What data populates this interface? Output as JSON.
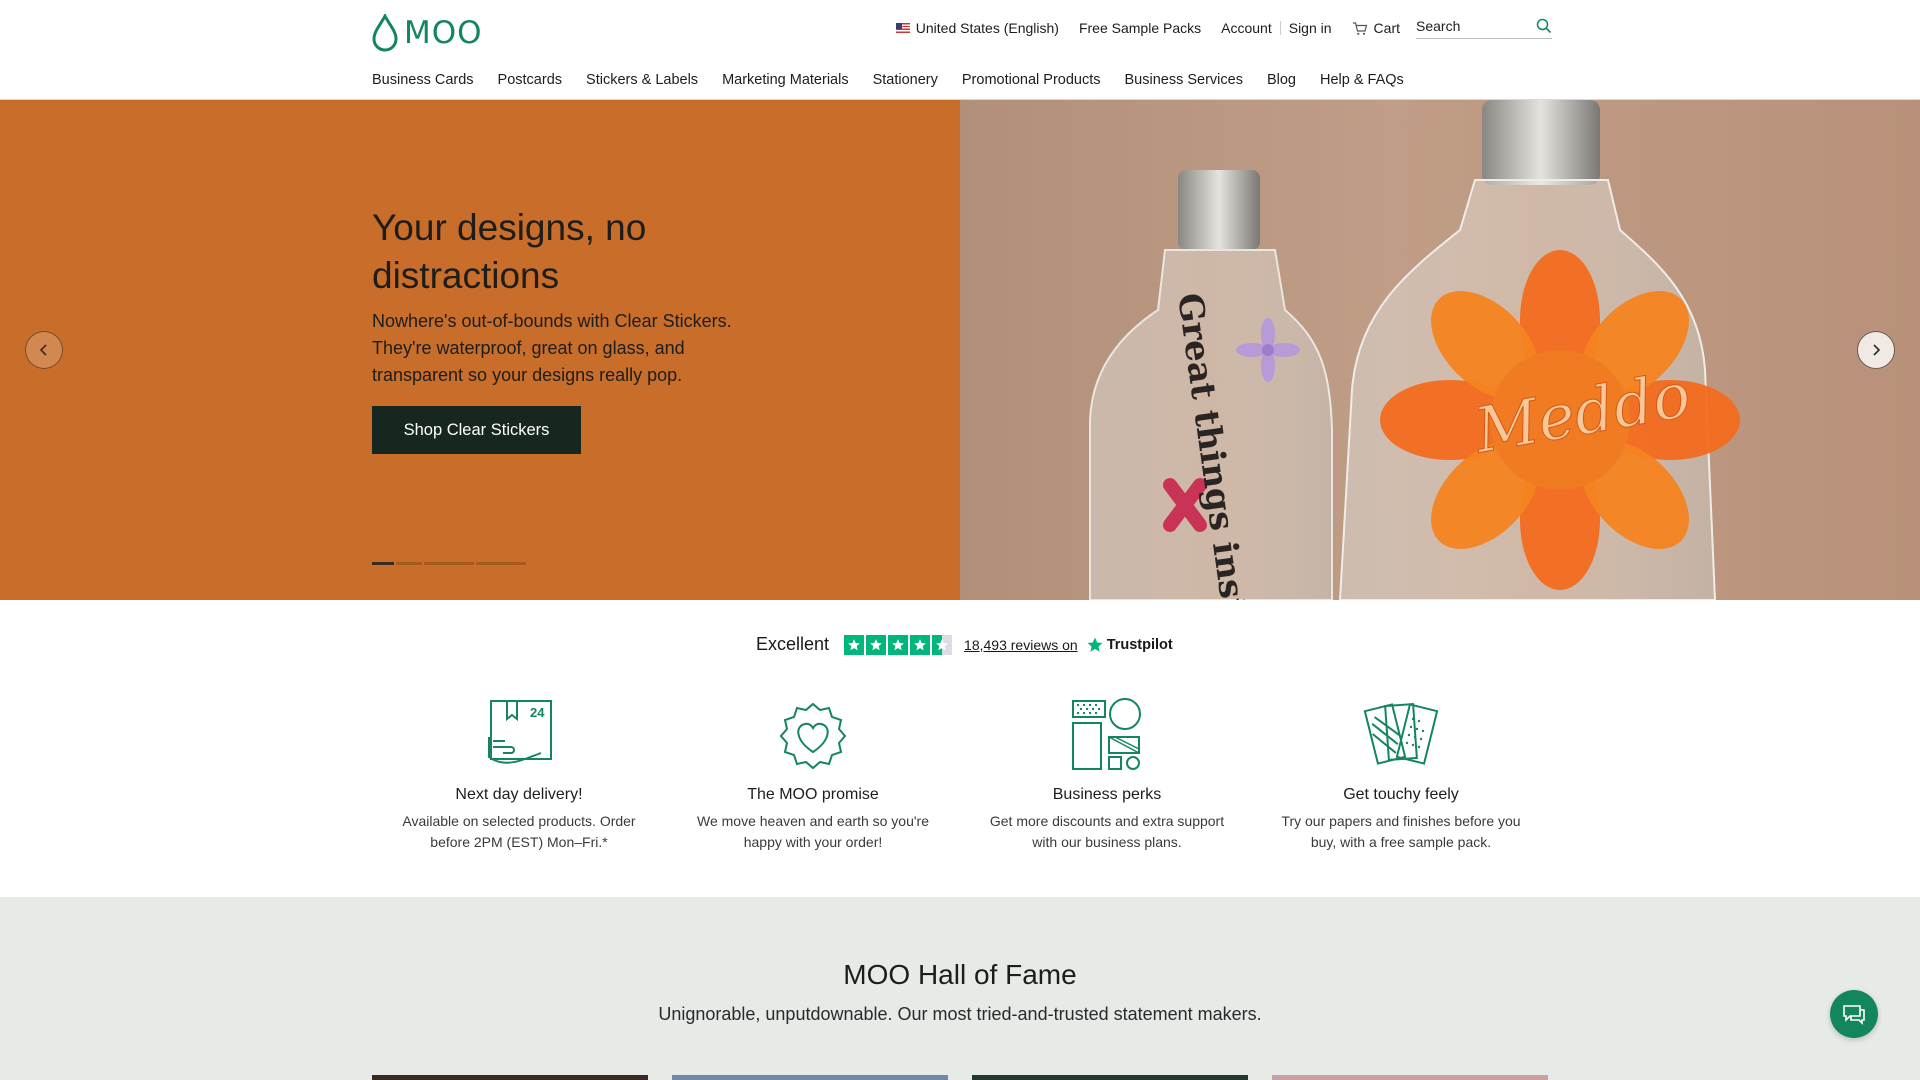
{
  "header": {
    "logo_text": "MOO",
    "utility": {
      "region": "United States (English)",
      "free_samples": "Free Sample Packs",
      "account": "Account",
      "sign_in": "Sign in",
      "cart": "Cart",
      "search_placeholder": "Search"
    },
    "nav": [
      "Business Cards",
      "Postcards",
      "Stickers & Labels",
      "Marketing Materials",
      "Stationery",
      "Promotional Products",
      "Business Services",
      "Blog",
      "Help & FAQs"
    ]
  },
  "hero": {
    "title": "Your designs, no distractions",
    "description": "Nowhere's out-of-bounds with Clear Stickers. They're waterproof, great on glass, and transparent so your designs really pop.",
    "cta": "Shop Clear Stickers",
    "slide_count": 4,
    "active_slide": 1,
    "image_text_left": "Great things inside!",
    "image_text_right": "Meddo"
  },
  "trustpilot": {
    "rating_label": "Excellent",
    "stars": 4.5,
    "reviews": "18,493 reviews on",
    "brand": "Trustpilot"
  },
  "features": [
    {
      "icon": "delivery-box-icon",
      "badge": "24",
      "title": "Next day delivery!",
      "text": "Available on selected products. Order before 2PM (EST) Mon–Fri.*"
    },
    {
      "icon": "heart-badge-icon",
      "title": "The MOO promise",
      "text": "We move heaven and earth so you're happy with your order!"
    },
    {
      "icon": "business-shapes-icon",
      "title": "Business perks",
      "text": "Get more discounts and extra support with our business plans."
    },
    {
      "icon": "paper-samples-icon",
      "title": "Get touchy feely",
      "text": "Try our papers and finishes before you buy, with a free sample pack."
    }
  ],
  "hall_of_fame": {
    "title": "MOO Hall of Fame",
    "subtitle": "Unignorable, unputdownable. Our most tried-and-trusted statement makers."
  },
  "colors": {
    "brand_green": "#14865d",
    "hero_orange": "#c86e2a",
    "cta_dark": "#17261f",
    "trustpilot_green": "#00b67a",
    "hof_background": "#e7ebe8"
  }
}
